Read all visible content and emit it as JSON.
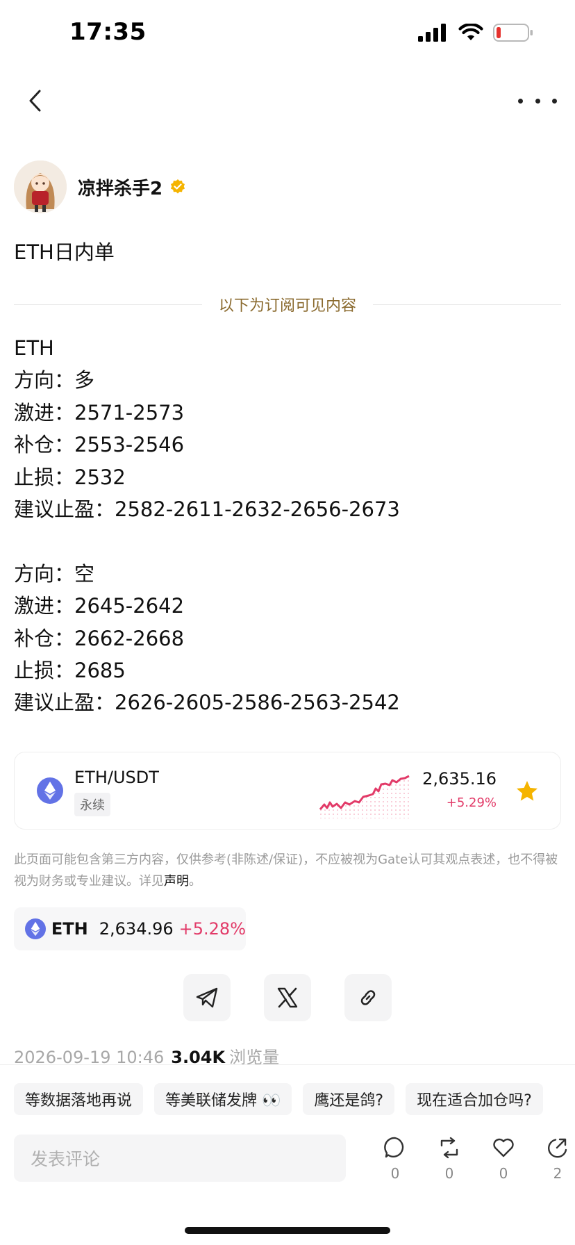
{
  "status_bar": {
    "time": "17:35"
  },
  "author": {
    "name": "凉拌杀手2",
    "verified": true
  },
  "post": {
    "title": "ETH日内单",
    "subscription_divider": "以下为订阅可见内容",
    "lines": [
      "ETH",
      "方向：多",
      "激进：2571-2573",
      "补仓：2553-2546",
      "止损：2532",
      "建议止盈：2582-2611-2632-2656-2673",
      "",
      "方向：空",
      "激进：2645-2642",
      "补仓：2662-2668",
      "止损：2685",
      "建议止盈：2626-2605-2586-2563-2542"
    ]
  },
  "market_card": {
    "pair": "ETH/USDT",
    "tag": "永续",
    "price": "2,635.16",
    "change": "+5.29%",
    "favorited": true,
    "icon": "ethereum-icon",
    "accent_color": "#e23a68"
  },
  "disclaimer": {
    "text": "此页面可能包含第三方内容，仅供参考(非陈述/保证)，不应被视为Gate认可其观点表述，也不得被视为财务或专业建议。详见",
    "link_text": "声明",
    "suffix": "。"
  },
  "ticker_chip": {
    "symbol": "ETH",
    "price": "2,634.96",
    "change": "+5.28%"
  },
  "share_buttons": [
    "telegram-icon",
    "x-icon",
    "link-icon"
  ],
  "meta": {
    "date": "2026-09-19 10:46",
    "views": "3.04K",
    "views_label": "浏览量"
  },
  "suggestions": [
    "等数据落地再说",
    "等美联储发牌 👀",
    "鹰还是鸽?",
    "现在适合加仓吗?"
  ],
  "comment": {
    "placeholder": "发表评论"
  },
  "actions": [
    {
      "icon": "comment-icon",
      "count": "0"
    },
    {
      "icon": "repost-icon",
      "count": "0"
    },
    {
      "icon": "like-icon",
      "count": "0"
    },
    {
      "icon": "share-icon",
      "count": "2"
    }
  ]
}
